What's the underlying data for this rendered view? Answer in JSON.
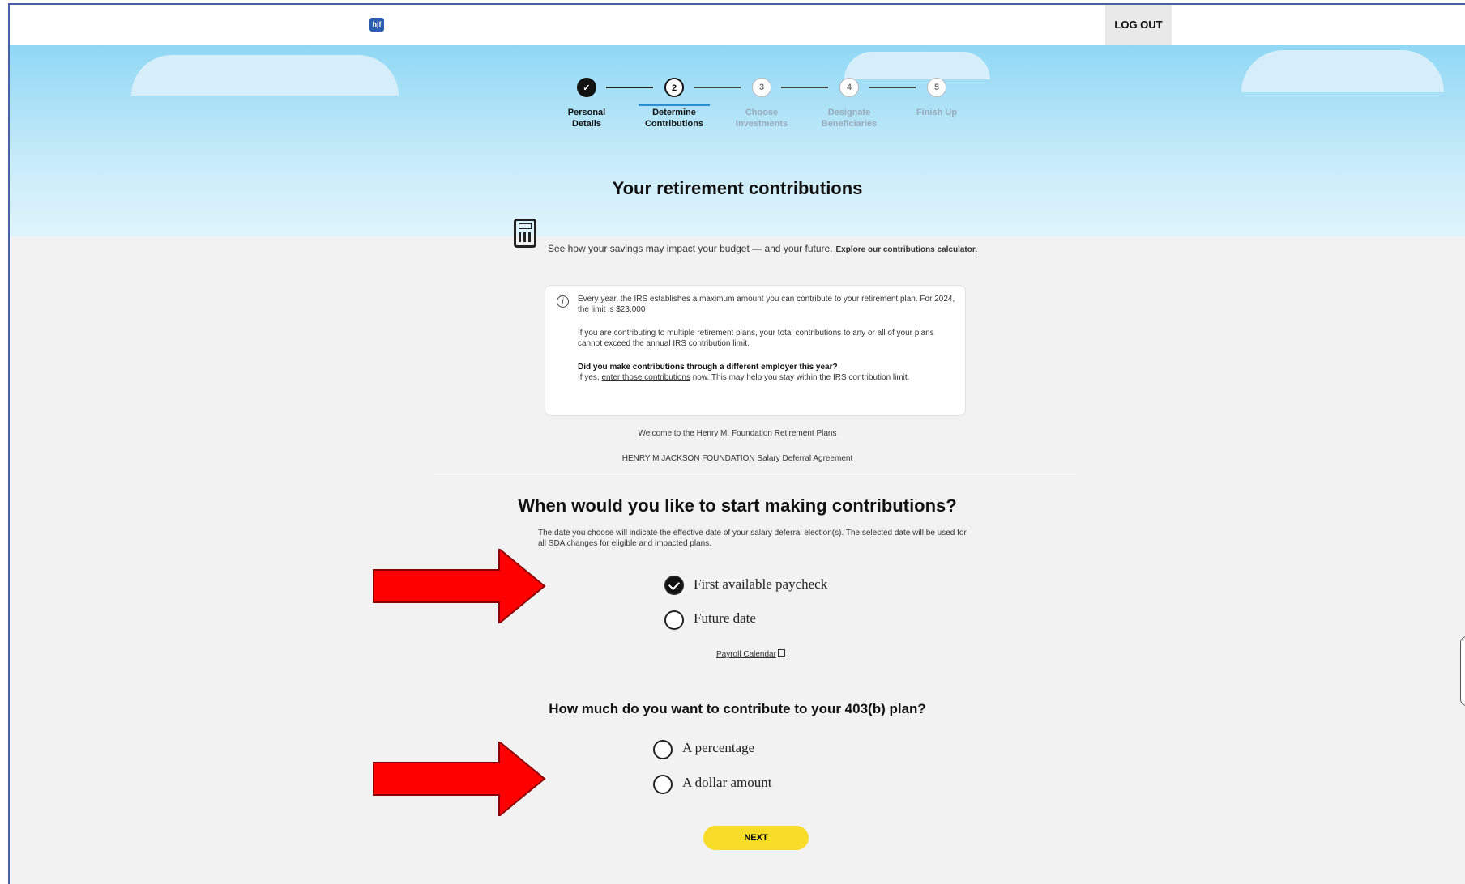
{
  "header": {
    "logo_text": "hjf",
    "logout_label": "LOG OUT"
  },
  "stepper": {
    "steps": [
      {
        "number": "✓",
        "label_line1": "Personal",
        "label_line2": "Details",
        "state": "complete"
      },
      {
        "number": "2",
        "label_line1": "Determine",
        "label_line2": "Contributions",
        "state": "current"
      },
      {
        "number": "3",
        "label_line1": "Choose",
        "label_line2": "Investments",
        "state": "upcoming"
      },
      {
        "number": "4",
        "label_line1": "Designate",
        "label_line2": "Beneficiaries",
        "state": "upcoming"
      },
      {
        "number": "5",
        "label_line1": "Finish Up",
        "label_line2": "",
        "state": "upcoming"
      }
    ]
  },
  "page": {
    "title": "Your retirement contributions",
    "calculator_text": "See how your savings may impact your budget — and your future.",
    "calculator_link": "Explore our contributions calculator."
  },
  "info_box": {
    "icon": "info-icon",
    "para1": "Every year, the IRS establishes a maximum amount you can contribute to your retirement plan. For 2024, the limit is $23,000",
    "para2": "If you are contributing to multiple retirement plans, your total contributions to any or all of your plans cannot exceed the annual IRS contribution limit.",
    "question": "Did you make contributions through a different employer this year?",
    "para3_before": "If yes, ",
    "para3_link": "enter those contributions",
    "para3_after": " now. This may help you stay within the IRS contribution limit."
  },
  "welcome_text": "Welcome to the Henry M. Foundation Retirement Plans",
  "agreement_text": "HENRY M JACKSON FOUNDATION Salary Deferral Agreement",
  "start_section": {
    "heading": "When would you like to start making contributions?",
    "description": "The date you choose will indicate the effective date of your salary deferral election(s). The selected date will be used for all SDA changes for eligible and impacted plans.",
    "options": [
      {
        "label": "First available paycheck",
        "selected": true
      },
      {
        "label": "Future date",
        "selected": false
      }
    ],
    "payroll_link": "Payroll Calendar"
  },
  "amount_section": {
    "heading": "How much do you want to contribute to your 403(b) plan?",
    "options": [
      {
        "label": "A percentage",
        "selected": false
      },
      {
        "label": "A dollar amount",
        "selected": false
      }
    ]
  },
  "next_label": "NEXT",
  "colors": {
    "accent_blue": "#2d5fb0",
    "button_yellow": "#f7dc2a",
    "arrow_red": "#ff0000"
  }
}
